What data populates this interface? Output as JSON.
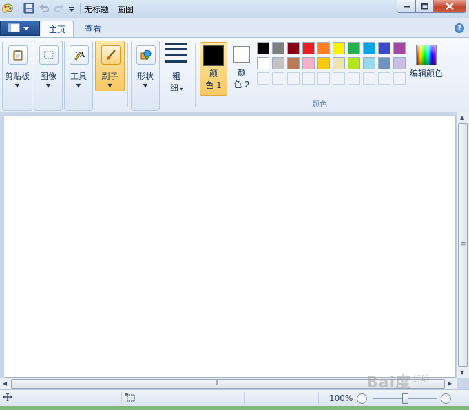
{
  "window": {
    "title": "无标题 - 画图"
  },
  "tabs": [
    {
      "label": "主页",
      "active": true
    },
    {
      "label": "查看",
      "active": false
    }
  ],
  "groups": {
    "clipboard": "剪贴板",
    "image": "图像",
    "tools": "工具",
    "brushes": "刷子",
    "shapes": "形状",
    "size": "粗\n细",
    "size_line1": "粗",
    "size_line2": "细",
    "color1_line1": "颜",
    "color1_line2": "色 1",
    "color2_line1": "颜",
    "color2_line2": "色 2",
    "edit_colors": "编辑颜色",
    "colors_group": "颜色"
  },
  "palette": {
    "row1": [
      "#000000",
      "#7f7f7f",
      "#880015",
      "#ed1c24",
      "#ff7f27",
      "#fff200",
      "#22b14c",
      "#00a2e8",
      "#3f48cc",
      "#a349a4"
    ],
    "row2": [
      "#ffffff",
      "#c3c3c3",
      "#b97a57",
      "#ffaec9",
      "#ffc90e",
      "#efe4b0",
      "#b5e61d",
      "#99d9ea",
      "#7092be",
      "#c8bfe7"
    ],
    "color1": "#000000",
    "color2": "#ffffff"
  },
  "statusbar": {
    "zoom": "100%",
    "zoom_fraction": 0.5
  },
  "watermark": {
    "brand": "Bai度",
    "sub": "经验"
  }
}
